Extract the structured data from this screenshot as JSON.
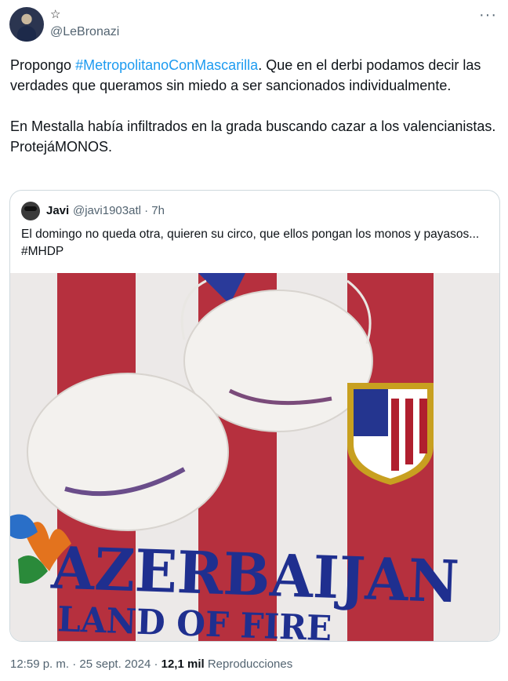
{
  "author": {
    "handle": "@LeBronazi",
    "badge_icon": "star-icon",
    "more_icon": "more-icon"
  },
  "tweet": {
    "p1_pre": "Propongo ",
    "p1_hashtag": "#MetropolitanoConMascarilla",
    "p1_post": ". Que en el derbi podamos decir las verdades que queramos sin miedo a ser sancionados individualmente.",
    "p2": "En Mestalla había infiltrados en la grada buscando cazar a los valencianistas. ProtejáMONOS."
  },
  "quoted": {
    "name": "Javi",
    "meta": "@javi1903atl · 7h",
    "text": "El domingo no queda otra, quieren su circo, que ellos pongan los monos y payasos... #MHDP",
    "image": {
      "line1": "AZERBAIJAN",
      "line2": "LAND OF FIRE"
    }
  },
  "footer": {
    "timestamp": "12:59 p. m. · 25 sept. 2024 · ",
    "views_count": "12,1 mil",
    "views_label": " Reproducciones"
  },
  "colors": {
    "link": "#1d9bf0",
    "secondary_text": "#536471",
    "stripe_red": "#b01f2e",
    "sponsor_blue": "#1f2f8f"
  }
}
